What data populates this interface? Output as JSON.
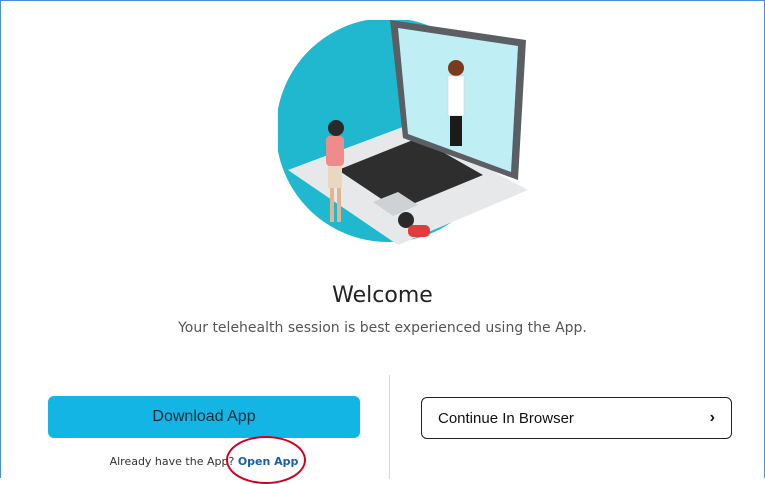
{
  "welcome": {
    "title": "Welcome",
    "subtitle": "Your telehealth session is best experienced using the App."
  },
  "actions": {
    "download_label": "Download App",
    "browser_label": "Continue In Browser",
    "browser_chevron": "›"
  },
  "already": {
    "prefix": "Already have the App?",
    "link": "Open App"
  },
  "colors": {
    "accent": "#13b5e4",
    "link": "#1a5fa8",
    "highlight": "#d0021b",
    "frame": "#4a90d9"
  },
  "icons": {
    "hero": "telehealth-laptop-illustration",
    "chevron": "chevron-right-icon"
  }
}
